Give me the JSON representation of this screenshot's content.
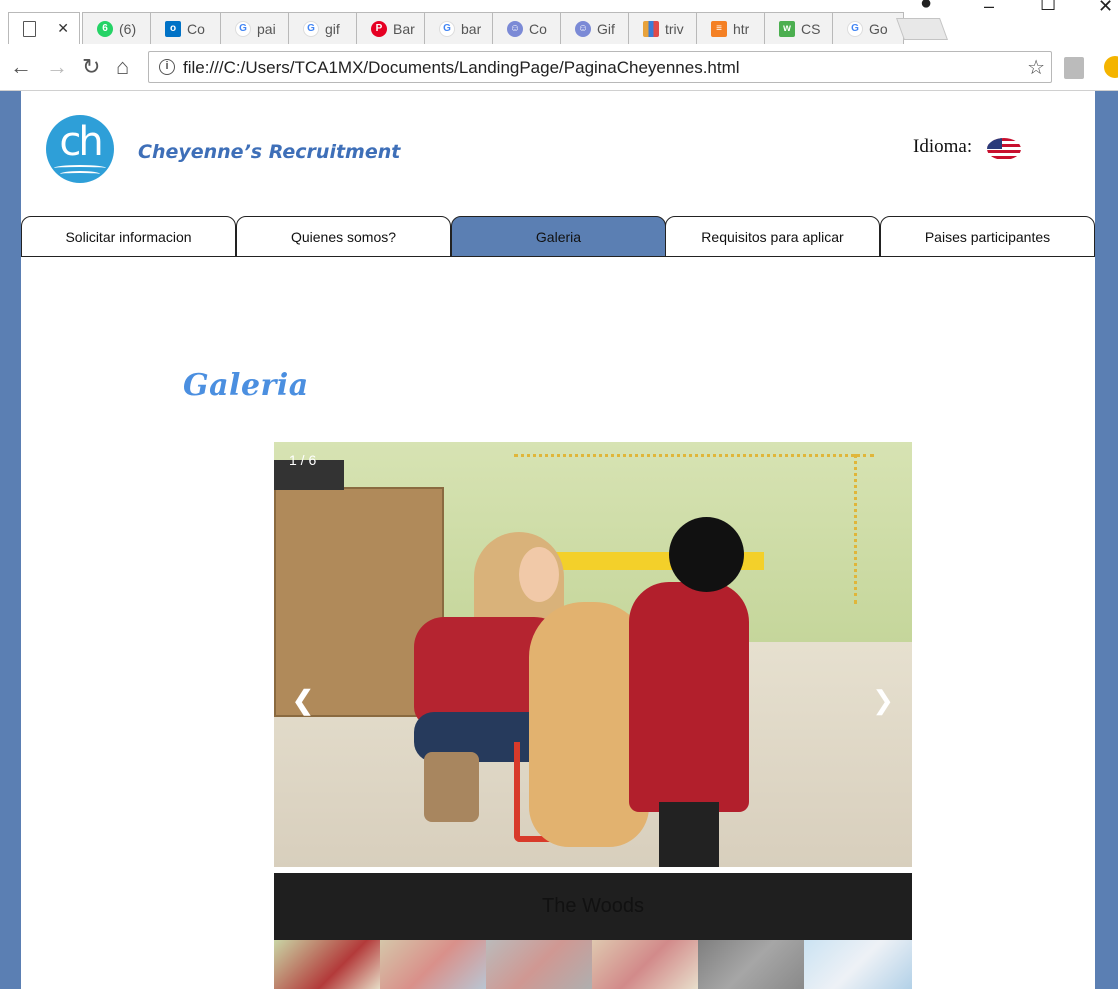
{
  "browser": {
    "tabs": [
      {
        "title": "",
        "icon": "page-icon",
        "color": "#ffffff"
      },
      {
        "title": "(6)",
        "icon": "whatsapp-icon",
        "color": "#25d366"
      },
      {
        "title": "Co",
        "icon": "outlook-icon",
        "color": "#0072c6"
      },
      {
        "title": "pai",
        "icon": "google-icon",
        "color": "#4285f4"
      },
      {
        "title": "gif",
        "icon": "google-icon",
        "color": "#4285f4"
      },
      {
        "title": "Bar",
        "icon": "pinterest-icon",
        "color": "#e60023"
      },
      {
        "title": "bar",
        "icon": "google-icon",
        "color": "#4285f4"
      },
      {
        "title": "Co",
        "icon": "app-icon",
        "color": "#7b8ad6"
      },
      {
        "title": "Gif",
        "icon": "app-icon",
        "color": "#7b8ad6"
      },
      {
        "title": "triv",
        "icon": "chart-icon",
        "color": "#e8a33d"
      },
      {
        "title": "htr",
        "icon": "stackoverflow-icon",
        "color": "#f48024"
      },
      {
        "title": "CS",
        "icon": "w3-icon",
        "color": "#4caf50"
      },
      {
        "title": "Go",
        "icon": "google-icon",
        "color": "#4285f4"
      }
    ],
    "url": "file:///C:/Users/TCA1MX/Documents/LandingPage/PaginaCheyennes.html"
  },
  "header": {
    "logo_text": "ch",
    "brand": "Cheyenne’s Recruitment",
    "language_label": "Idioma:"
  },
  "nav": {
    "items": [
      {
        "label": "Solicitar informacion"
      },
      {
        "label": "Quienes somos?"
      },
      {
        "label": "Galeria",
        "active": true
      },
      {
        "label": "Requisitos para aplicar"
      },
      {
        "label": "Paises participantes"
      }
    ]
  },
  "gallery": {
    "title": "Galeria",
    "counter": "1 / 6",
    "prev": "❮",
    "next": "❯",
    "caption": "The Woods"
  },
  "colors": {
    "accent": "#5b7fb3",
    "title": "#4b8fe0",
    "brand": "#3e6fb8"
  }
}
